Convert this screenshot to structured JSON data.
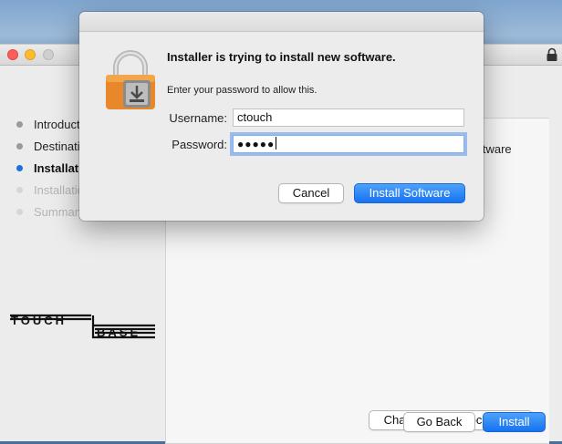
{
  "installer": {
    "steps": [
      {
        "label": "Introduction",
        "state": "done"
      },
      {
        "label": "Destination",
        "state": "done"
      },
      {
        "label": "Installation",
        "state": "active"
      },
      {
        "label": "Installation",
        "state": "future"
      },
      {
        "label": "Summary",
        "state": "future"
      }
    ],
    "behind_text": "oftware",
    "logo_text": "TOUCH BASE",
    "change_location_label": "Change Install Location...",
    "go_back_label": "Go Back",
    "install_label": "Install"
  },
  "dialog": {
    "title": "Installer is trying to install new software.",
    "message": "Enter your password to allow this.",
    "username_label": "Username:",
    "username_value": "ctouch",
    "password_label": "Password:",
    "password_value": "●●●●●",
    "cancel_label": "Cancel",
    "confirm_label": "Install Software"
  },
  "colors": {
    "accent": "#1672f0",
    "close": "#fc5f57",
    "minimize": "#fdbc2e",
    "lock_orange": "#e8882a"
  }
}
